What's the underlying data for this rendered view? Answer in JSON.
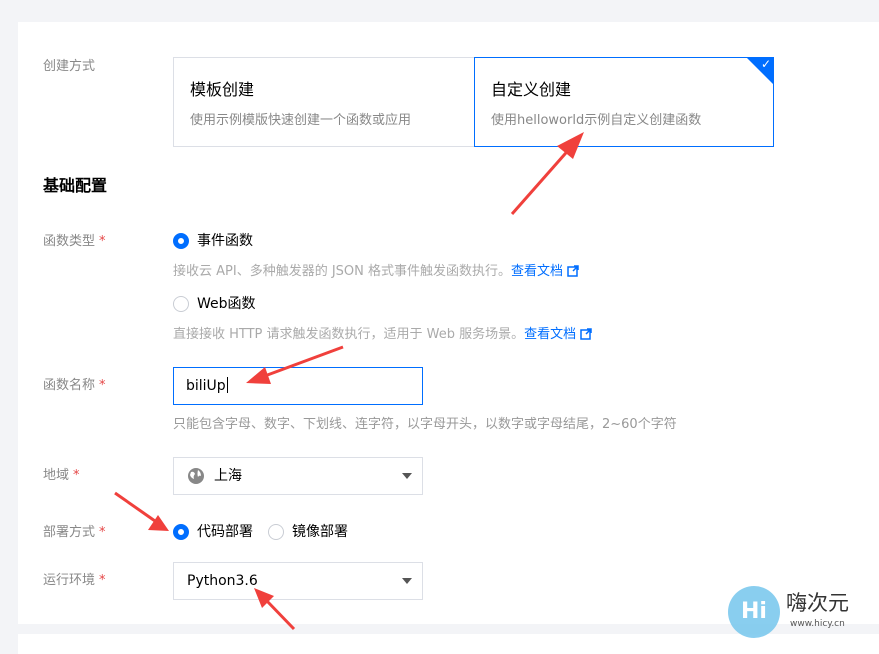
{
  "create": {
    "label": "创建方式",
    "options": [
      {
        "title": "模板创建",
        "desc": "使用示例模版快速创建一个函数或应用"
      },
      {
        "title": "自定义创建",
        "desc": "使用helloworld示例自定义创建函数",
        "selected": true
      }
    ]
  },
  "basic": {
    "title": "基础配置",
    "func_type": {
      "label": "函数类型",
      "required_mark": "*",
      "options": [
        {
          "text": "事件函数",
          "selected": true,
          "hint": "接收云 API、多种触发器的 JSON 格式事件触发函数执行。",
          "link": "查看文档"
        },
        {
          "text": "Web函数",
          "selected": false,
          "hint": "直接接收 HTTP 请求触发函数执行，适用于 Web 服务场景。",
          "link": "查看文档"
        }
      ]
    },
    "func_name": {
      "label": "函数名称",
      "required_mark": "*",
      "value": "biliUp",
      "hint": "只能包含字母、数字、下划线、连字符，以字母开头，以数字或字母结尾，2~60个字符"
    },
    "region": {
      "label": "地域",
      "required_mark": "*",
      "value": "上海",
      "icon": "globe-icon"
    },
    "deploy": {
      "label": "部署方式",
      "required_mark": "*",
      "options": [
        {
          "text": "代码部署",
          "selected": true
        },
        {
          "text": "镜像部署",
          "selected": false
        }
      ]
    },
    "runtime": {
      "label": "运行环境",
      "required_mark": "*",
      "value": "Python3.6"
    }
  },
  "watermark": {
    "circle_text": "Hi",
    "name": "嗨次元",
    "url": "www.hicy.cn"
  },
  "colors": {
    "accent": "#006eff",
    "required": "#e54545",
    "annotation_arrow": "#f0403c"
  }
}
